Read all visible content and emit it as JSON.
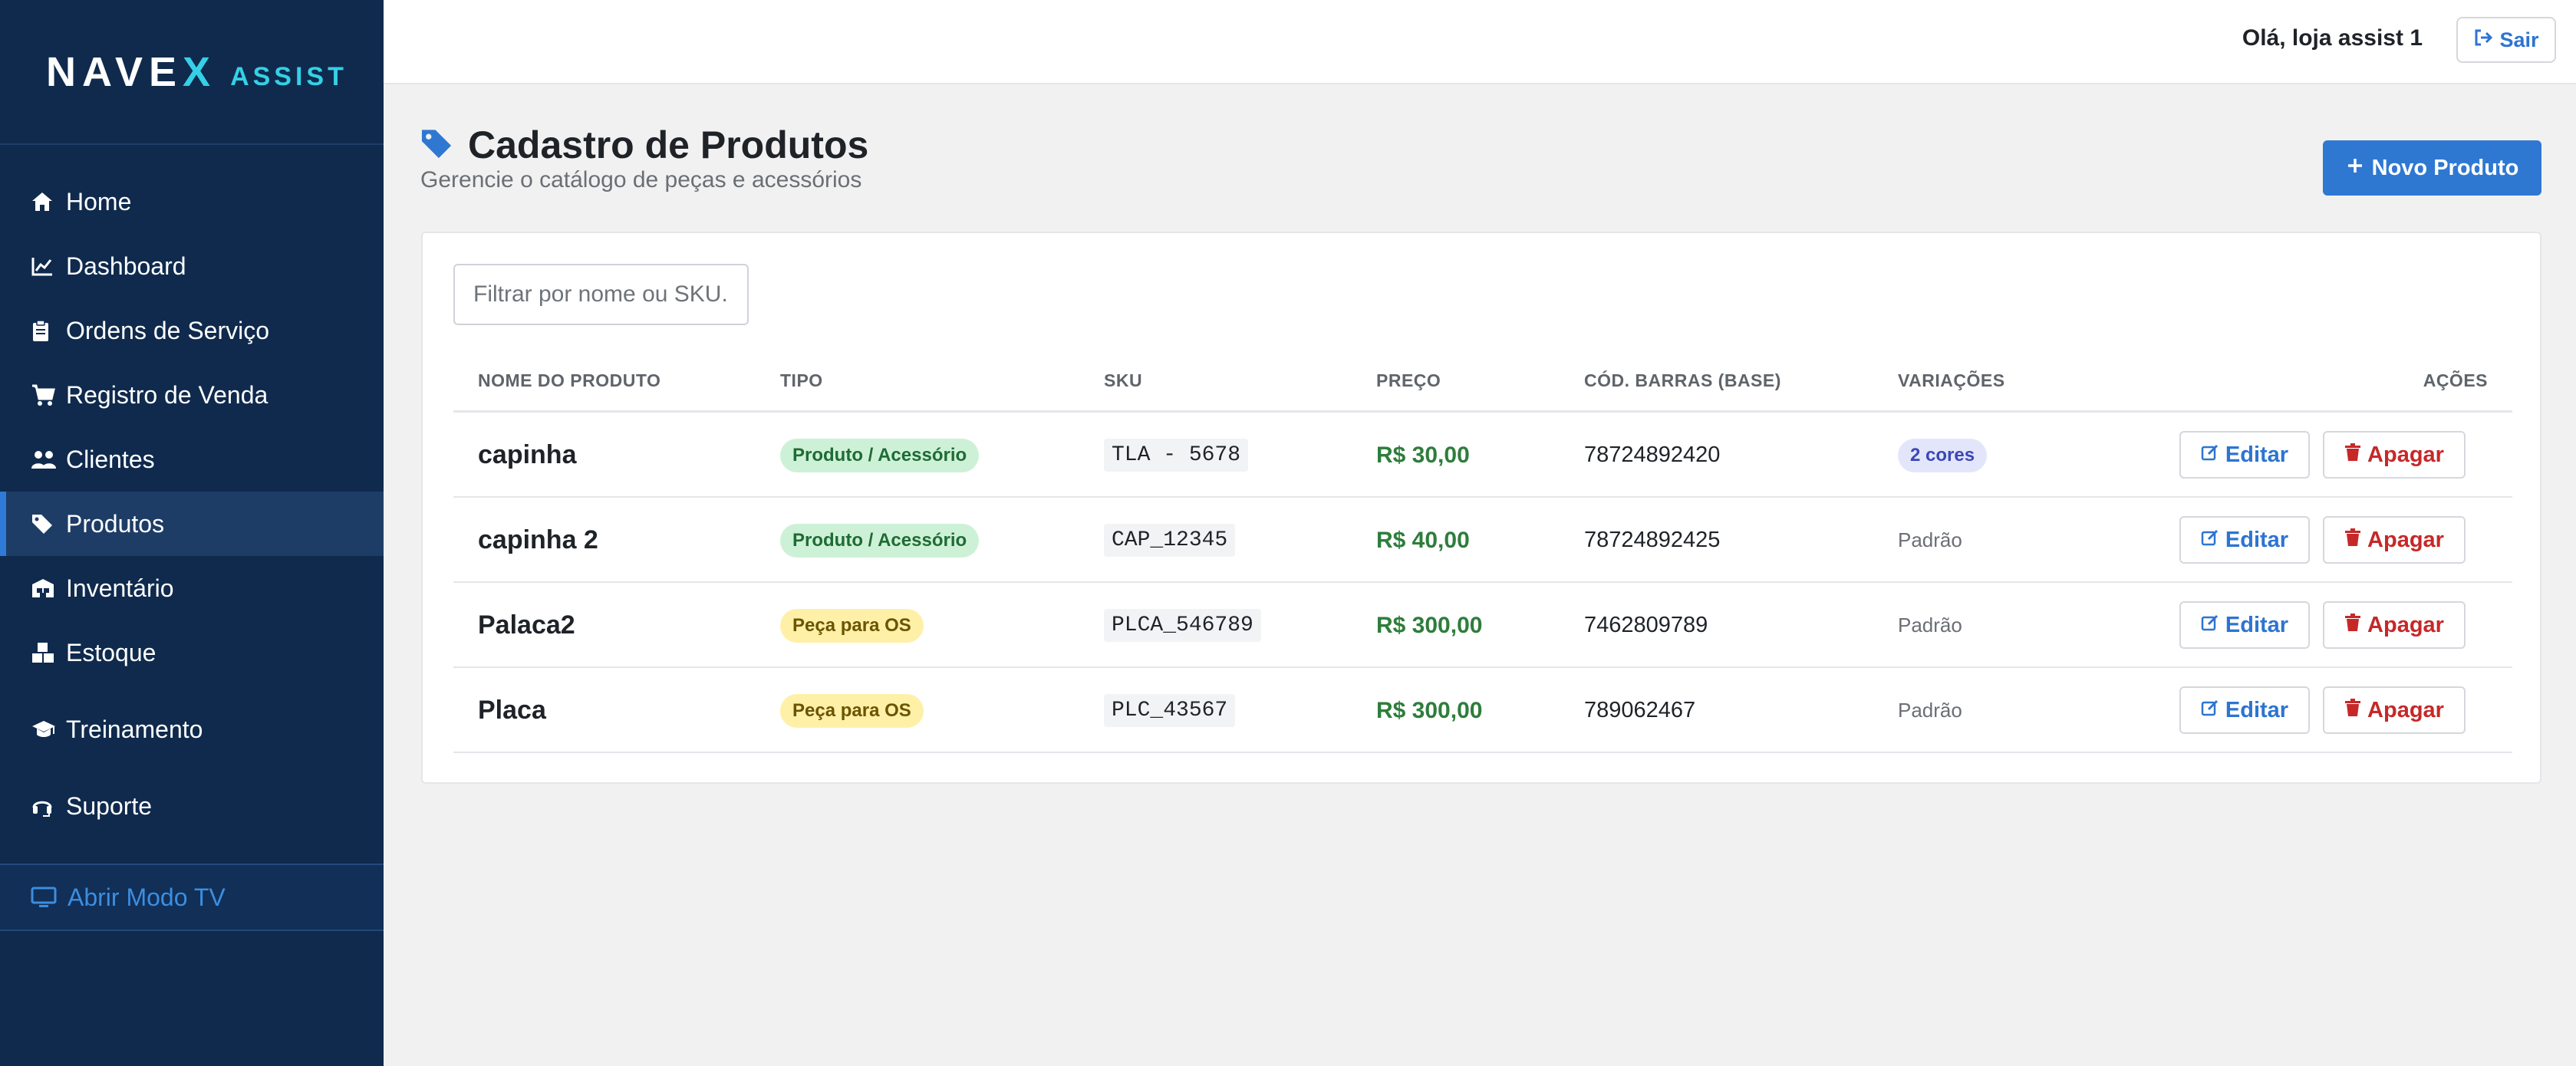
{
  "brand": {
    "name_pre": "NAVE",
    "name_x": "X",
    "sub": "ASSIST"
  },
  "sidebar": {
    "items": [
      {
        "label": "Home",
        "icon": "home-icon",
        "active": false
      },
      {
        "label": "Dashboard",
        "icon": "chart-line-icon",
        "active": false
      },
      {
        "label": "Ordens de Serviço",
        "icon": "clipboard-icon",
        "active": false
      },
      {
        "label": "Registro de Venda",
        "icon": "cart-icon",
        "active": false
      },
      {
        "label": "Clientes",
        "icon": "users-icon",
        "active": false
      },
      {
        "label": "Produtos",
        "icon": "tag-icon",
        "active": true
      },
      {
        "label": "Inventário",
        "icon": "warehouse-icon",
        "active": false
      },
      {
        "label": "Estoque",
        "icon": "boxes-icon",
        "active": false
      },
      {
        "label": "Treinamento",
        "icon": "graduation-cap-icon",
        "active": false
      },
      {
        "label": "Suporte",
        "icon": "headset-icon",
        "active": false
      }
    ],
    "tv_mode": "Abrir Modo TV"
  },
  "topbar": {
    "greeting": "Olá, loja assist 1",
    "logout_label": "Sair"
  },
  "page": {
    "title": "Cadastro de Produtos",
    "subtitle": "Gerencie o catálogo de peças e acessórios",
    "new_button": "Novo Produto"
  },
  "filter": {
    "placeholder": "Filtrar por nome ou SKU."
  },
  "table": {
    "headers": [
      "NOME DO PRODUTO",
      "TIPO",
      "SKU",
      "PREÇO",
      "CÓD. BARRAS (BASE)",
      "VARIAÇÕES",
      "AÇÕES"
    ],
    "rows": [
      {
        "name": "capinha",
        "type": "Produto / Acessório",
        "type_kind": "prod",
        "sku": "TLA - 5678",
        "price": "R$ 30,00",
        "barcode": "78724892420",
        "variations": "2 cores",
        "variation_kind": "badge"
      },
      {
        "name": "capinha 2",
        "type": "Produto / Acessório",
        "type_kind": "prod",
        "sku": "CAP_12345",
        "price": "R$ 40,00",
        "barcode": "78724892425",
        "variations": "Padrão",
        "variation_kind": "plain"
      },
      {
        "name": "Palaca2",
        "type": "Peça para OS",
        "type_kind": "os",
        "sku": "PLCA_546789",
        "price": "R$ 300,00",
        "barcode": "7462809789",
        "variations": "Padrão",
        "variation_kind": "plain"
      },
      {
        "name": "Placa",
        "type": "Peça para OS",
        "type_kind": "os",
        "sku": "PLC_43567",
        "price": "R$ 300,00",
        "barcode": "789062467",
        "variations": "Padrão",
        "variation_kind": "plain"
      }
    ],
    "edit_label": "Editar",
    "delete_label": "Apagar"
  },
  "colors": {
    "sidebar_bg": "#0f2a4d",
    "accent": "#2f78d2",
    "brand_cyan": "#35d0e6",
    "price_green": "#2e7d3c",
    "danger": "#c62828"
  }
}
